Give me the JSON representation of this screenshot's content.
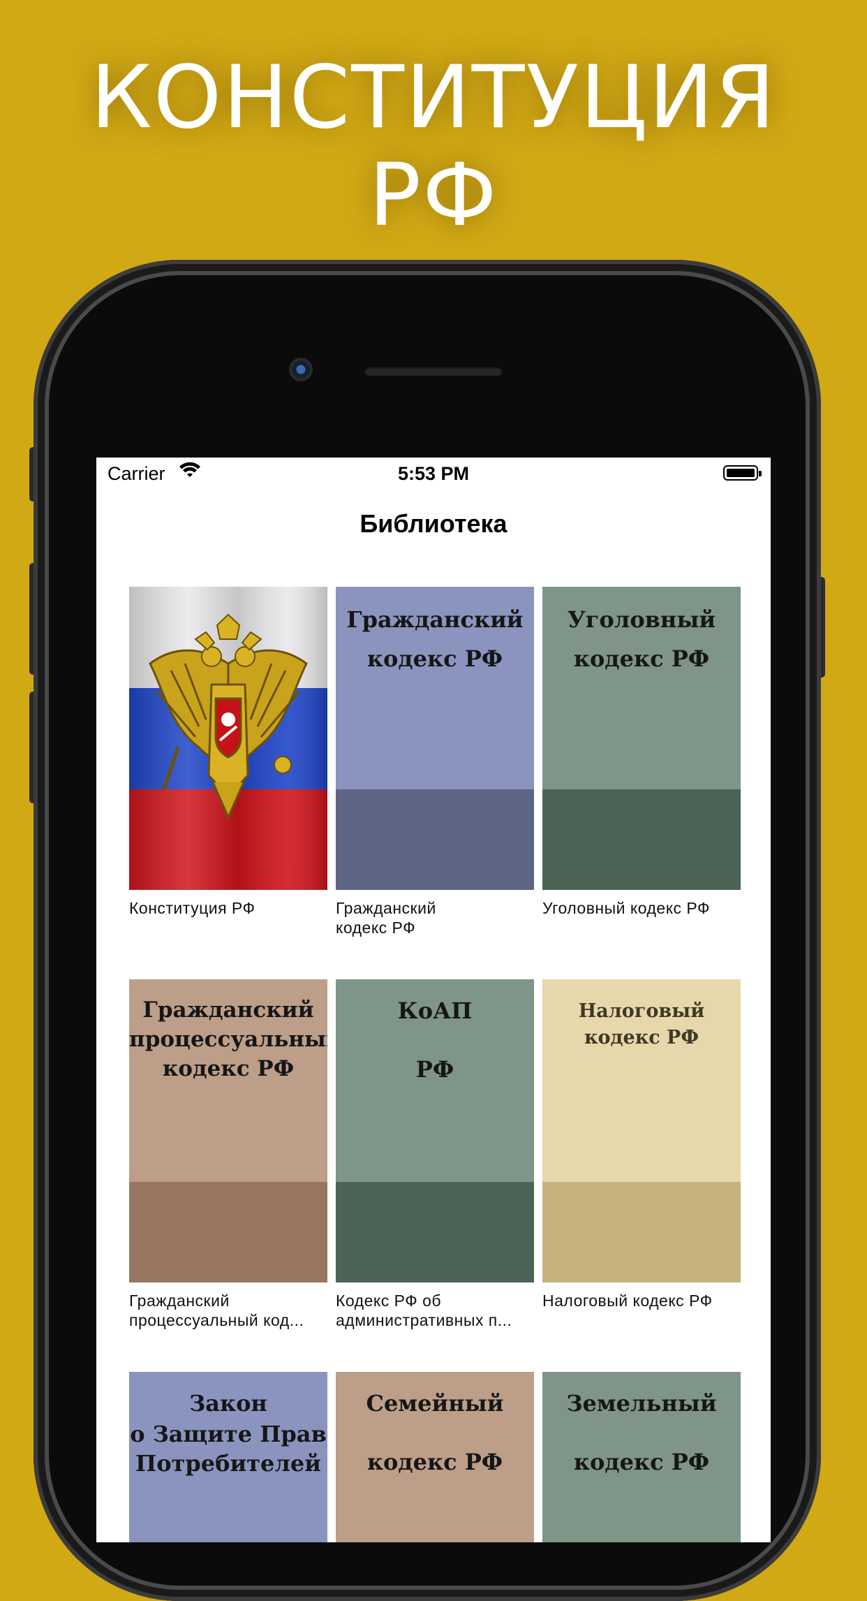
{
  "headline": {
    "line1": "КОНСТИТУЦИЯ",
    "line2": "РФ"
  },
  "status": {
    "carrier": "Carrier",
    "time": "5:53 PM"
  },
  "nav": {
    "title": "Библиотека"
  },
  "books": [
    {
      "cover_type": "flag",
      "caption": "Конституция РФ"
    },
    {
      "cover_line1": "Гражданский",
      "cover_line2": "кодекс РФ",
      "caption": "Гражданский\nкодекс РФ",
      "top_color": "#8b94bf",
      "bottom_color": "#5f6584"
    },
    {
      "cover_line1": "Уголовный",
      "cover_line2": "кодекс РФ",
      "caption": "Уголовный кодекс РФ",
      "top_color": "#7e9588",
      "bottom_color": "#4c6456"
    },
    {
      "cover_line1": "Гражданский",
      "cover_line2": "процессуальный",
      "cover_line3": "кодекс РФ",
      "caption": "Гражданский\nпроцессуальный код...",
      "top_color": "#bc9e89",
      "bottom_color": "#98765f"
    },
    {
      "cover_line1": "КоАП",
      "cover_line2": "РФ",
      "caption": "Кодекс РФ об\nадминистративных п...",
      "top_color": "#7e9588",
      "bottom_color": "#4c6456"
    },
    {
      "cover_line1": "Налоговый",
      "cover_line2": "кодекс РФ",
      "caption": "Налоговый кодекс РФ",
      "top_color": "#e6d8aa",
      "bottom_color": "#c7b17c"
    },
    {
      "cover_line1": "Закон",
      "cover_line2": "о Защите Прав",
      "cover_line3": "Потребителей",
      "top_color": "#8b94bf"
    },
    {
      "cover_line1": "Семейный",
      "cover_line2": "кодекс РФ",
      "top_color": "#bc9e89"
    },
    {
      "cover_line1": "Земельный",
      "cover_line2": "кодекс РФ",
      "top_color": "#7e9588"
    }
  ]
}
